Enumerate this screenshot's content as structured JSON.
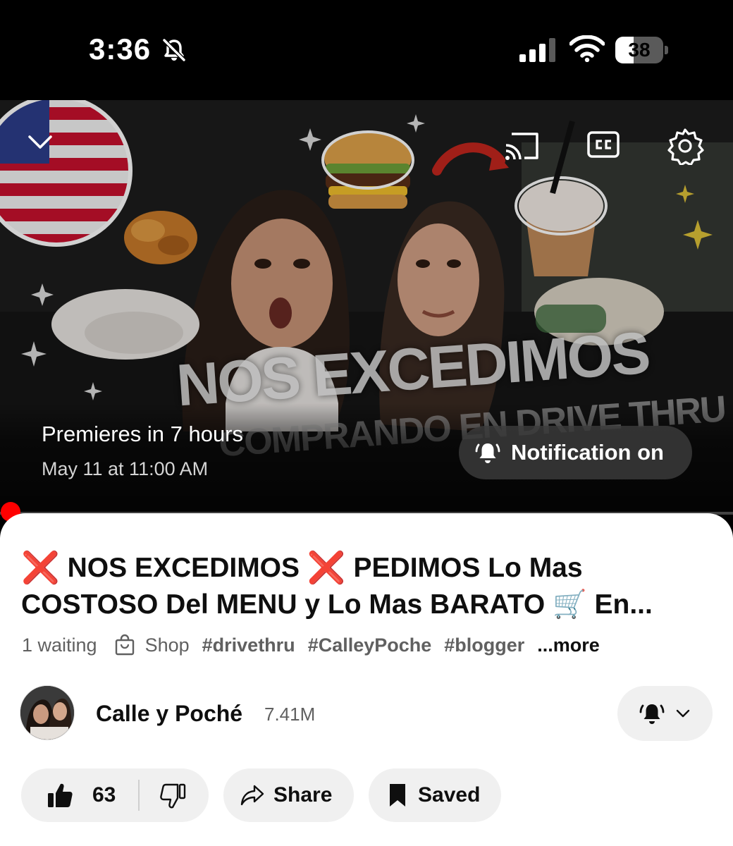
{
  "status_bar": {
    "time": "3:36",
    "battery_percent": "38",
    "battery_level": 0.38,
    "icons": [
      "bell-slash-icon",
      "signal-icon",
      "wifi-icon",
      "battery-icon"
    ]
  },
  "player": {
    "thumbnail_headline": "NOS EXCEDIMOS",
    "thumbnail_subline": "COMPRANDO EN DRIVE THRU",
    "premiere_title": "Premieres in 7 hours",
    "premiere_date": "May 11 at 11:00 AM",
    "notification_label": "Notification on",
    "controls": [
      "chevron-down-icon",
      "cast-icon",
      "closed-captions-icon",
      "settings-icon"
    ],
    "accent_color": "#ff0000"
  },
  "video": {
    "title_line1_a": "NOS EXCEDIMOS",
    "title_line1_b": "PEDIMOS Lo Mas",
    "title_line2": "COSTOSO Del MENU y Lo Mas BARATO 🛒 En...",
    "title_mark": "❌",
    "waiting": "1 waiting",
    "shop_label": "Shop",
    "hashtags": [
      "#drivethru",
      "#CalleyPoche",
      "#blogger"
    ],
    "more_label": "...more"
  },
  "channel": {
    "name": "Calle y Poché",
    "subscribers": "7.41M"
  },
  "actions": {
    "like_count": "63",
    "share_label": "Share",
    "saved_label": "Saved"
  }
}
